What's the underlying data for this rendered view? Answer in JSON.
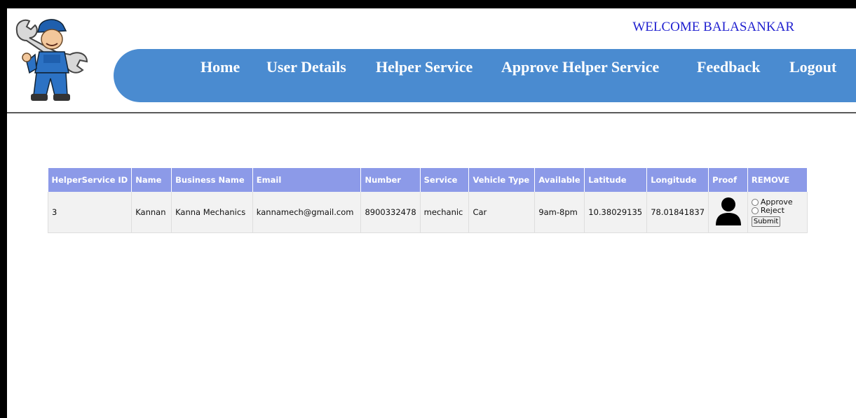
{
  "header": {
    "welcome": "WELCOME BALASANKAR"
  },
  "nav": {
    "home": "Home",
    "user_details": "User Details",
    "helper_service": "Helper Service",
    "approve_helper_service": "Approve Helper Service",
    "feedback": "Feedback",
    "logout": "Logout"
  },
  "table": {
    "headers": [
      "HelperService ID",
      "Name",
      "Business Name",
      "Email",
      "Number",
      "Service",
      "Vehicle Type",
      "Available",
      "Latitude",
      "Longitude",
      "Proof",
      "REMOVE"
    ],
    "rows": [
      {
        "id": "3",
        "name": "Kannan",
        "business_name": "Kanna Mechanics",
        "email": "kannamech@gmail.com",
        "number": "8900332478",
        "service": "mechanic",
        "vehicle_type": "Car",
        "available": "9am-8pm",
        "latitude": "10.38029135",
        "longitude": "78.01841837",
        "proof_icon": "person-avatar-icon",
        "approve_label": "Approve",
        "reject_label": "Reject",
        "submit_label": "Submit"
      }
    ]
  },
  "colors": {
    "nav_bg": "#4a8bd0",
    "table_header_bg": "#8c9ae8",
    "welcome_text": "#1f1fcf"
  }
}
